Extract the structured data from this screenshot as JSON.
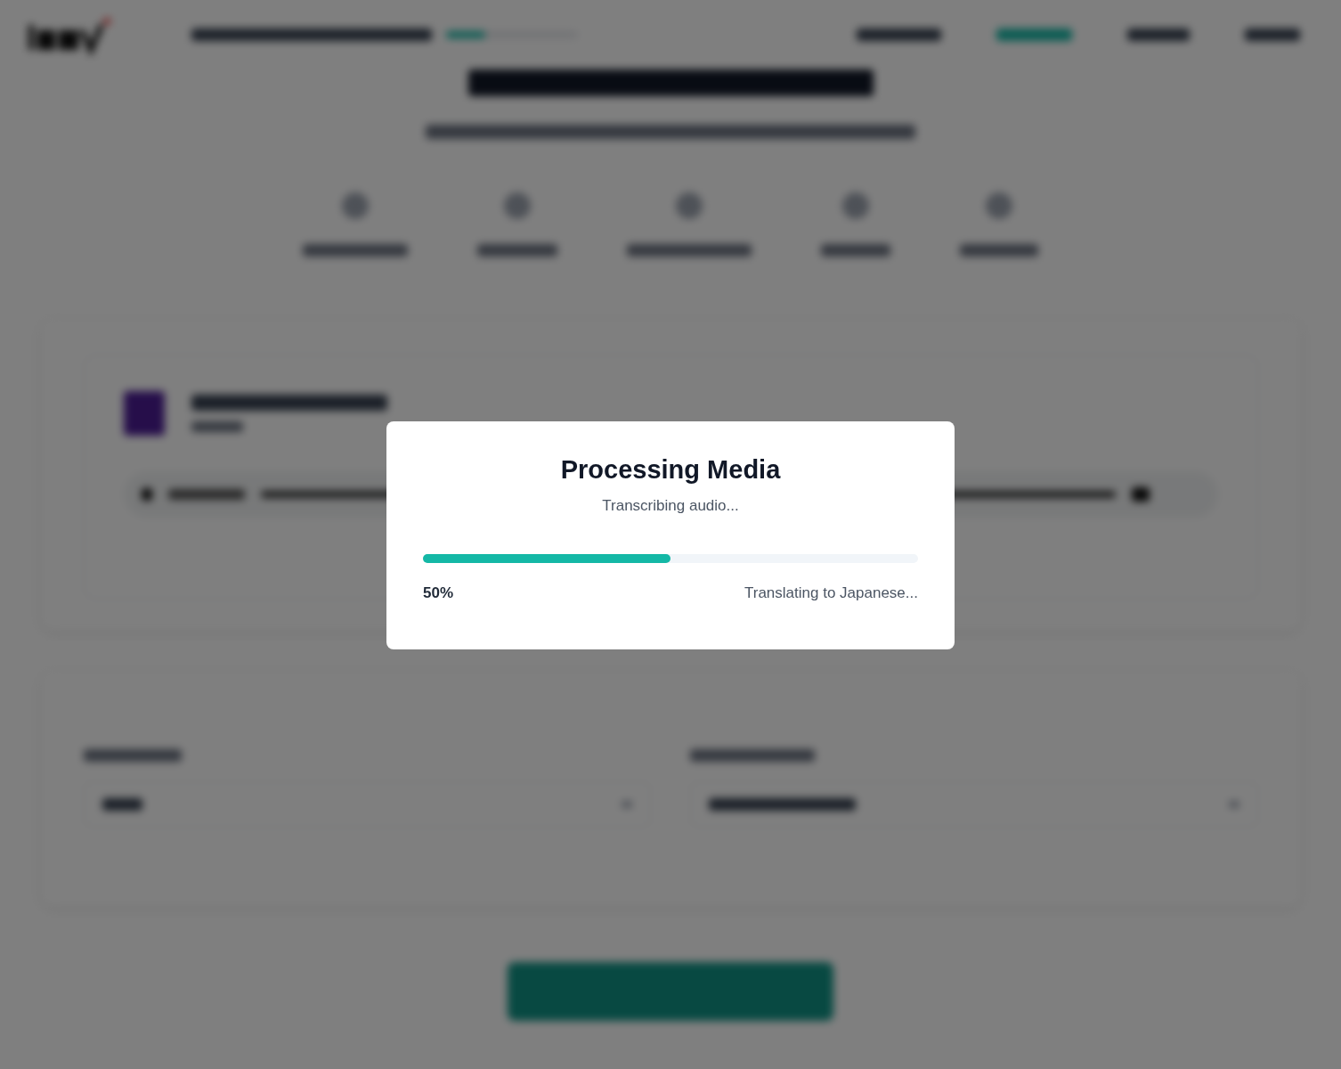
{
  "dialog": {
    "title": "Processing Media",
    "status": "Transcribing audio...",
    "progress": {
      "level": 0.5,
      "percent": "50%",
      "detail": "Translating to Japanese..."
    }
  }
}
